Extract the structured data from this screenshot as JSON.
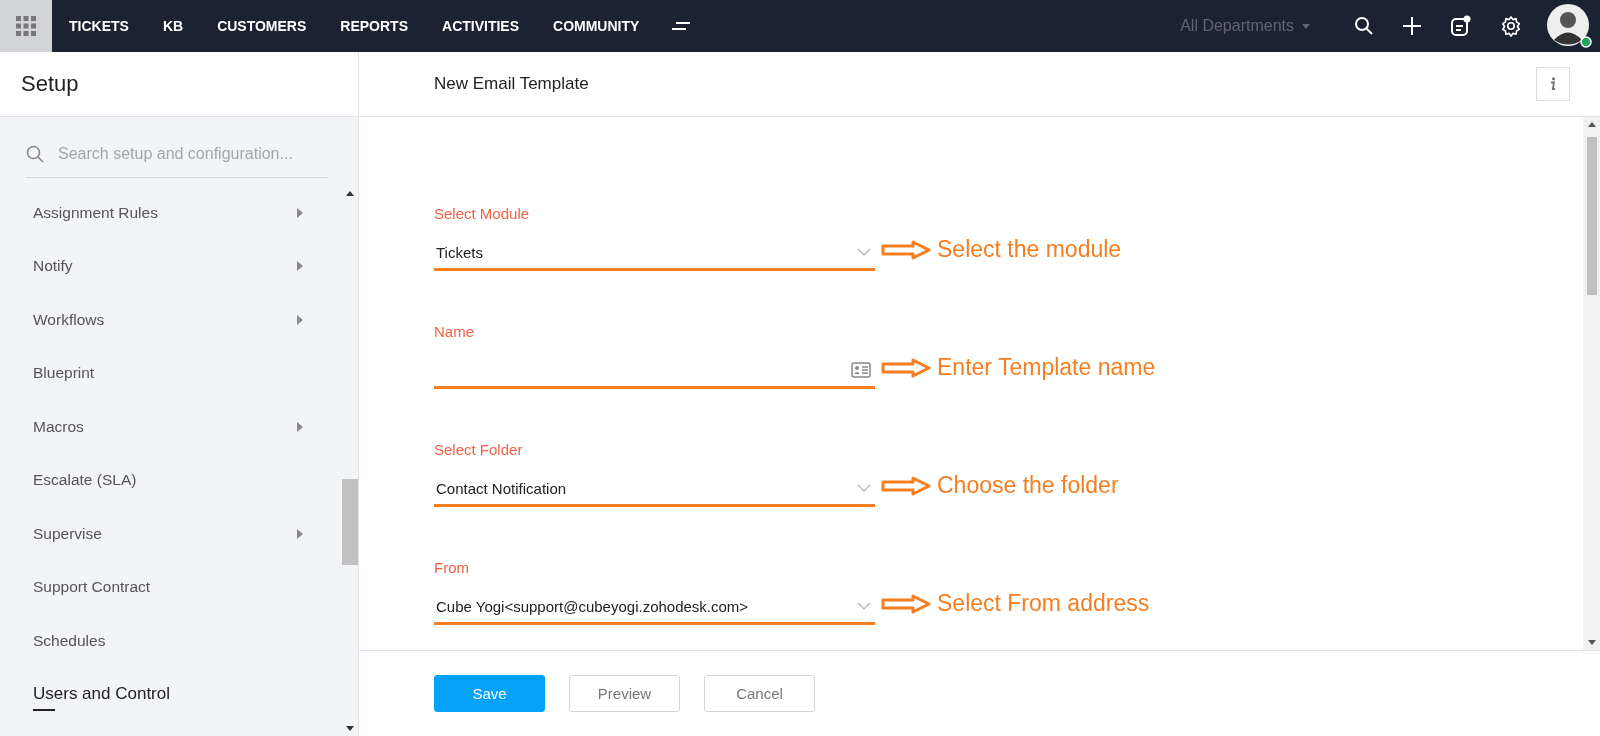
{
  "nav": {
    "tabs": [
      {
        "label": "TICKETS",
        "selected": false
      },
      {
        "label": "KB",
        "selected": false
      },
      {
        "label": "CUSTOMERS",
        "selected": false
      },
      {
        "label": "REPORTS",
        "selected": false
      },
      {
        "label": "ACTIVITIES",
        "selected": false
      },
      {
        "label": "COMMUNITY",
        "selected": false
      }
    ],
    "department": "All Departments"
  },
  "sidebar": {
    "title": "Setup",
    "search": {
      "placeholder": "Search setup and configuration..."
    },
    "items": [
      {
        "label": "Assignment Rules",
        "kind": "item",
        "expandable": true
      },
      {
        "label": "Notify",
        "kind": "item",
        "expandable": true
      },
      {
        "label": "Workflows",
        "kind": "item",
        "expandable": true
      },
      {
        "label": "Blueprint",
        "kind": "item",
        "expandable": false
      },
      {
        "label": "Macros",
        "kind": "item",
        "expandable": true
      },
      {
        "label": "Escalate (SLA)",
        "kind": "item",
        "expandable": false
      },
      {
        "label": "Supervise",
        "kind": "item",
        "expandable": true
      },
      {
        "label": "Support Contract",
        "kind": "item",
        "expandable": false
      },
      {
        "label": "Schedules",
        "kind": "item",
        "expandable": false
      },
      {
        "label": "Users and Control",
        "kind": "heading",
        "expandable": false
      }
    ]
  },
  "main": {
    "title": "New Email Template",
    "fields": [
      {
        "label": "Select Module",
        "kind": "select",
        "value": "Tickets",
        "annotation": "Select the module"
      },
      {
        "label": "Name",
        "kind": "text",
        "annotation": "Enter Template name"
      },
      {
        "label": "Select Folder",
        "kind": "select",
        "value": "Contact Notification",
        "annotation": "Choose the folder"
      },
      {
        "label": "From",
        "kind": "select",
        "value": "Cube Yogi<support@cubeyogi.zohodesk.com>",
        "annotation": "Select From address"
      }
    ],
    "buttons": [
      {
        "label": "Save",
        "kind": "primary"
      },
      {
        "label": "Preview",
        "kind": "secondary"
      },
      {
        "label": "Cancel",
        "kind": "secondary"
      }
    ]
  }
}
